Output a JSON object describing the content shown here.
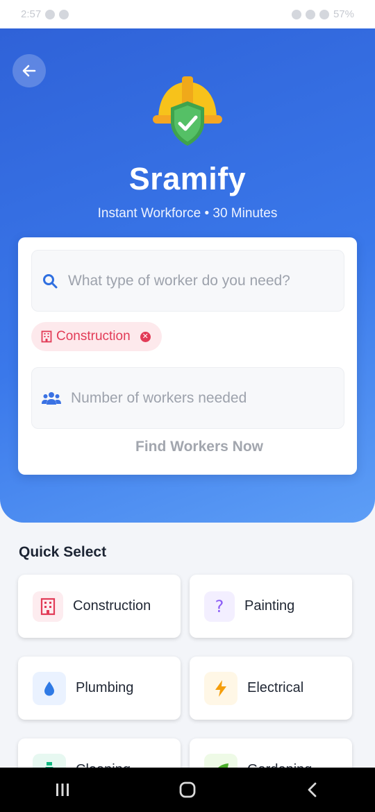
{
  "status_bar": {
    "time": "2:57",
    "battery": "57%"
  },
  "header": {
    "back_label": "Back",
    "title": "Sramify",
    "subtitle": "Instant Workforce • 30 Minutes"
  },
  "search": {
    "placeholder": "What type of worker do you need?",
    "value": ""
  },
  "selected_category": {
    "label": "Construction",
    "remove_icon": "close-circle-icon"
  },
  "workers": {
    "placeholder": "Number of workers needed",
    "value": ""
  },
  "find_button": {
    "label": "Find Workers Now"
  },
  "quick_select": {
    "title": "Quick Select",
    "items": [
      {
        "label": "Construction",
        "icon": "building-icon",
        "color": "#e23b57",
        "bg": "#fdecef"
      },
      {
        "label": "Painting",
        "icon": "question-icon",
        "color": "#8b5cf6",
        "bg": "#f3efff"
      },
      {
        "label": "Plumbing",
        "icon": "water-drop-icon",
        "color": "#2f7ae5",
        "bg": "#eaf2ff"
      },
      {
        "label": "Electrical",
        "icon": "lightning-icon",
        "color": "#f59e0b",
        "bg": "#fff7e6"
      },
      {
        "label": "Cleaning",
        "icon": "spray-bottle-icon",
        "color": "#10b981",
        "bg": "#e7f8f1"
      },
      {
        "label": "Gardening",
        "icon": "leaf-icon",
        "color": "#4caf2b",
        "bg": "#eefae6"
      }
    ]
  },
  "colors": {
    "primary": "#2f62d8",
    "accent_red": "#e23b57"
  }
}
